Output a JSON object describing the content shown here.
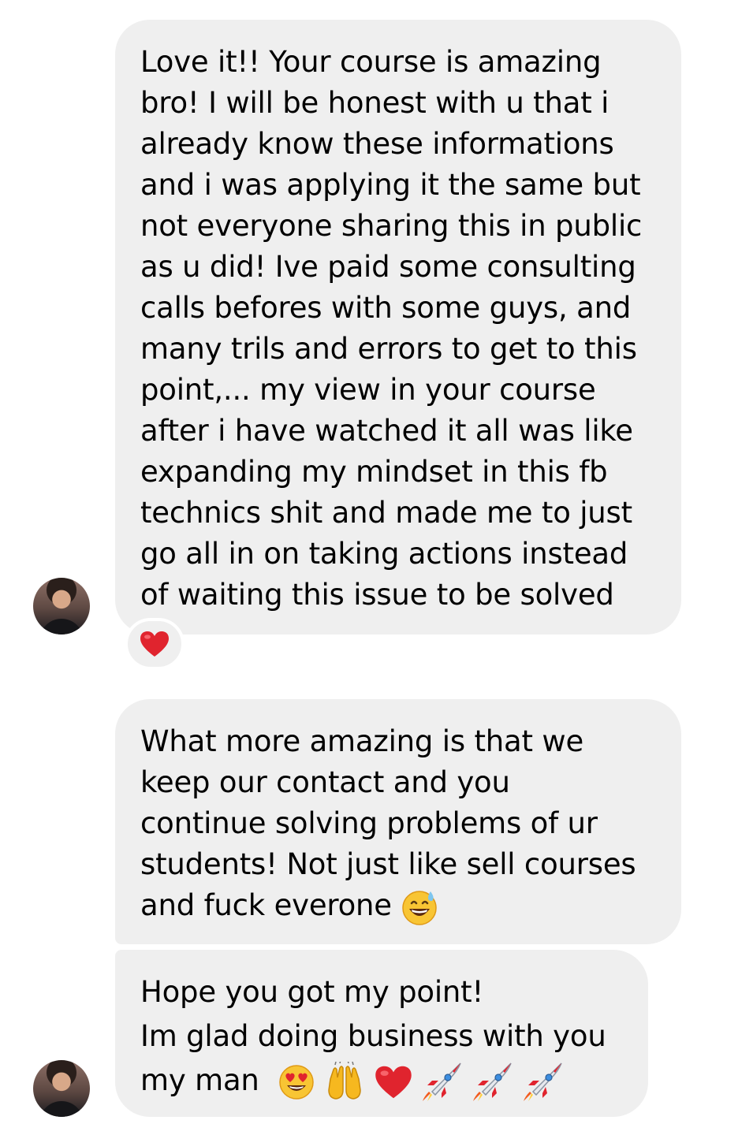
{
  "messages": [
    {
      "lines": [
        "Love it!! Your course is amazing",
        "bro!  I will be honest with u that i",
        "already know these informations",
        "and i was applying it the same but",
        "not everyone sharing this in public",
        "as u did! Ive paid some consulting",
        "calls befores with some guys, and",
        "many trils and errors to get to this",
        "point,... my view in your course",
        "after i have watched it all was like",
        "expanding my mindset in this fb",
        "technics shit and made me to just",
        "go all in on taking actions instead",
        "of waiting this issue to be solved"
      ],
      "reaction": "red-heart-emoji"
    },
    {
      "lines": [
        "What more amazing is that we",
        "keep our contact and you",
        "continue solving problems of ur",
        "students! Not just like sell courses",
        "and fuck everone"
      ],
      "trailing_emoji": [
        "grinning-sweat-emoji"
      ]
    },
    {
      "lines": [
        "Hope you got my point!",
        "Im glad doing business with you",
        "my man"
      ],
      "trailing_emoji": [
        "heart-eyes-emoji",
        "raising-hands-emoji",
        "red-heart-emoji",
        "rocket-emoji",
        "rocket-emoji",
        "rocket-emoji"
      ]
    }
  ],
  "colors": {
    "bubble": "#efefef",
    "text": "#000000",
    "background": "#ffffff",
    "heart": "#e0242e"
  }
}
